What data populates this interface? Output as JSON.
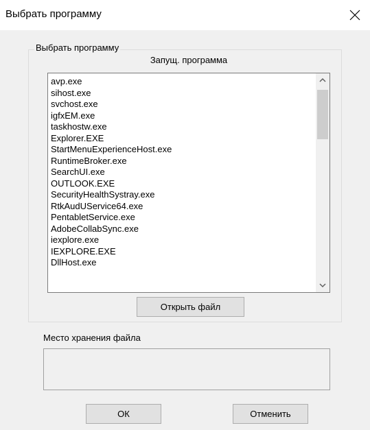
{
  "window": {
    "title": "Выбрать программу",
    "close_icon": "close-icon"
  },
  "group": {
    "label": "Выбрать программу",
    "list_header": "Запущ. программа",
    "items": [
      "avp.exe",
      "sihost.exe",
      "svchost.exe",
      "igfxEM.exe",
      "taskhostw.exe",
      "Explorer.EXE",
      "StartMenuExperienceHost.exe",
      "RuntimeBroker.exe",
      "SearchUI.exe",
      "OUTLOOK.EXE",
      "SecurityHealthSystray.exe",
      "RtkAudUService64.exe",
      "PentabletService.exe",
      "AdobeCollabSync.exe",
      "iexplore.exe",
      "IEXPLORE.EXE",
      "DllHost.exe"
    ],
    "open_file_label": "Открыть файл"
  },
  "storage": {
    "label": "Место хранения файла",
    "value": ""
  },
  "footer": {
    "ok_label": "ОК",
    "cancel_label": "Отменить"
  }
}
